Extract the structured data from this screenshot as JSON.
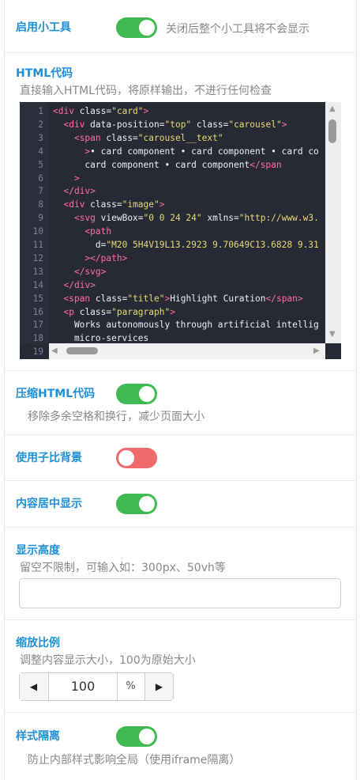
{
  "enable_tool": {
    "title": "启用小工具",
    "on": true,
    "desc": "关闭后整个小工具将不会显示"
  },
  "html_code": {
    "title": "HTML代码",
    "desc": "直接输入HTML代码，将原样输出，不进行任何检查",
    "editor": {
      "line_numbers": [
        "1",
        "2",
        "3",
        "4",
        "5",
        "6",
        "7",
        "8",
        "9",
        "10",
        "11",
        "12",
        "13",
        "14",
        "15",
        "16",
        "17",
        "18",
        "19"
      ],
      "lines": [
        "<div class=\"card\">",
        "  <div data-position=\"top\" class=\"carousel\">",
        "    <span class=\"carousel__text\"",
        "      >• card component • card component • card co",
        "      card component • card component</span",
        "    >",
        "  </div>",
        "  <div class=\"image\">",
        "    <svg viewBox=\"0 0 24 24\" xmlns=\"http://www.w3.",
        "      <path",
        "        d=\"M20 5H4V19L13.2923 9.70649C13.6828 9.31",
        "      ></path>",
        "    </svg>",
        "  </div>",
        "  <span class=\"title\">Highlight Curation</span>",
        "  <p class=\"paragraph\">",
        "    Works autonomously through artificial intellig",
        "    micro-services",
        ""
      ]
    }
  },
  "compress": {
    "title": "压缩HTML代码",
    "on": true,
    "desc": "移除多余空格和换行，减少页面大小"
  },
  "use_ratio_bg": {
    "title": "使用子比背景",
    "on": false
  },
  "center": {
    "title": "内容居中显示",
    "on": true
  },
  "height": {
    "title": "显示高度",
    "desc": "留空不限制，可输入如：300px、50vh等",
    "value": "",
    "placeholder": ""
  },
  "scale": {
    "title": "缩放比例",
    "desc": "调整内容显示大小，100为原始大小",
    "value": "100",
    "unit": "%"
  },
  "isolation": {
    "title": "样式隔离",
    "on": true,
    "desc": "防止内部样式影响全局（使用iframe隔离）"
  },
  "colors": {
    "accent": "#1e90d6",
    "toggle_on": "#3fba52",
    "toggle_off": "#ee6b6b",
    "editor_bg": "#272935"
  }
}
